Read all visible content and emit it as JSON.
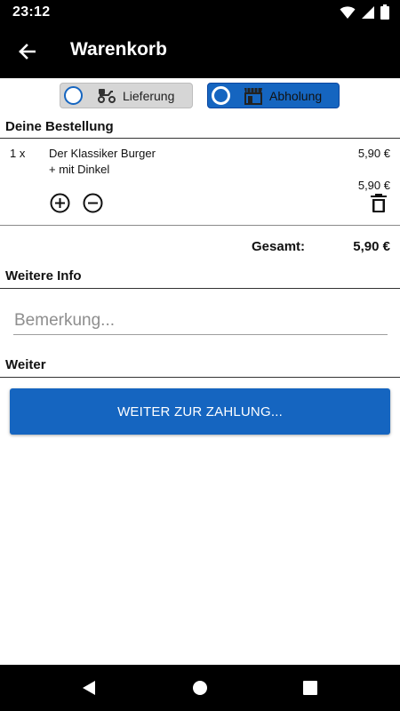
{
  "status_bar": {
    "time": "23:12"
  },
  "app_bar": {
    "title": "Warenkorb"
  },
  "order_type": {
    "delivery_label": "Lieferung",
    "pickup_label": "Abholung",
    "selected": "pickup",
    "accent_color": "#1565c0"
  },
  "order": {
    "section_title": "Deine Bestellung",
    "items": [
      {
        "quantity": "1 x",
        "name": "Der Klassiker Burger",
        "extra": "+ mit Dinkel",
        "price": "5,90 €",
        "subtotal": "5,90 €"
      }
    ],
    "total_label": "Gesamt:",
    "total_value": "5,90 €"
  },
  "info": {
    "section_title": "Weitere Info",
    "remark_placeholder": "Bemerkung...",
    "remark_value": ""
  },
  "next": {
    "section_title": "Weiter",
    "button_label": "WEITER ZUR ZAHLUNG..."
  },
  "icons": {
    "back": "arrow-left-icon",
    "delivery": "scooter-icon",
    "pickup": "storefront-icon",
    "increase": "plus-circle-icon",
    "decrease": "minus-circle-icon",
    "delete": "trash-icon"
  }
}
